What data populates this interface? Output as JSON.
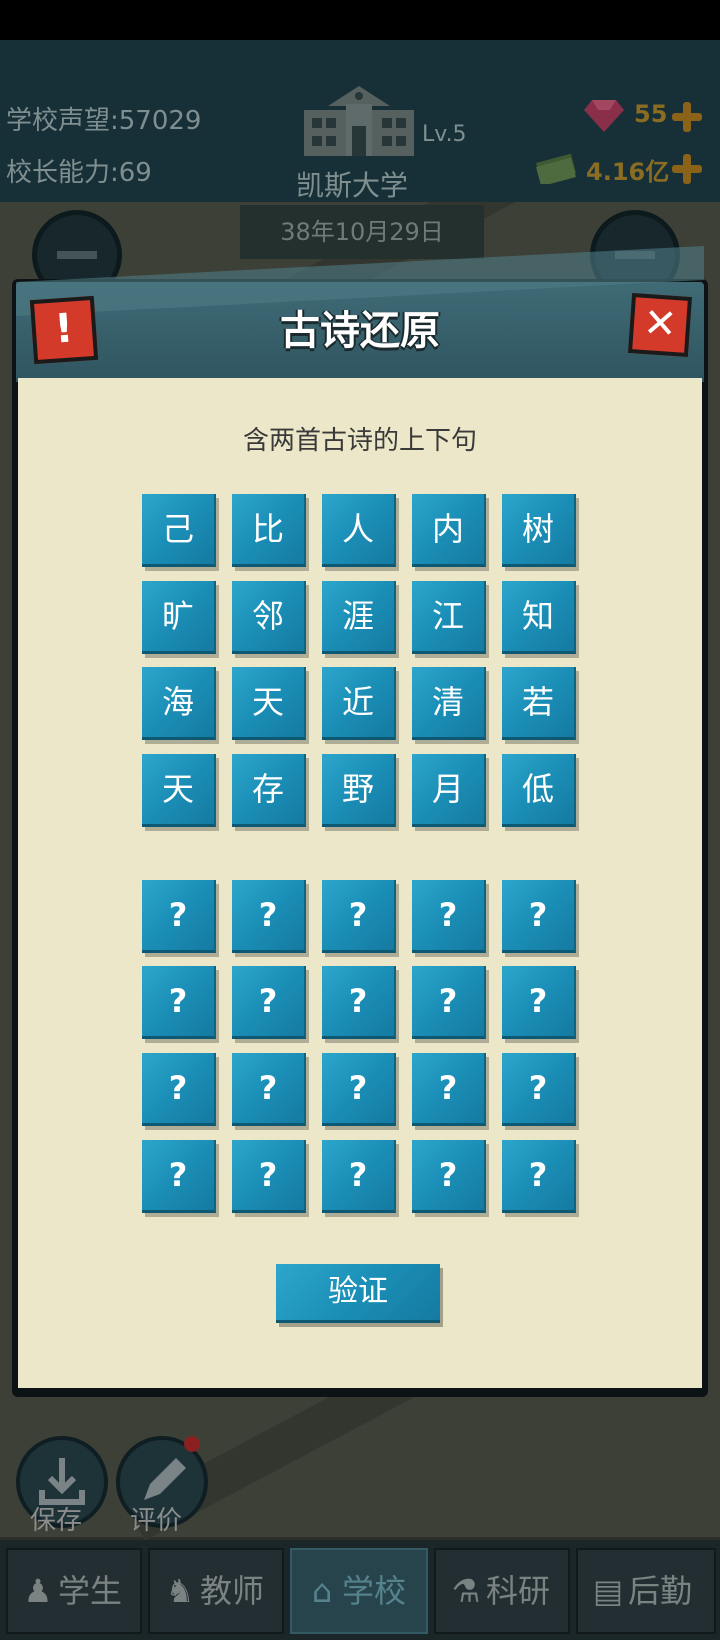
{
  "hud": {
    "reputation_label": "学校声望:",
    "reputation_value": "57029",
    "ability_label": "校长能力:",
    "ability_value": "69",
    "school_level": "Lv.5",
    "school_name": "凯斯大学",
    "date": "38年10月29日",
    "gems": "55",
    "money": "4.16亿"
  },
  "modal": {
    "title": "古诗还原",
    "subtitle": "含两首古诗的上下句",
    "alert_glyph": "!",
    "close_glyph": "✕",
    "char_tiles": [
      "己",
      "比",
      "人",
      "内",
      "树",
      "旷",
      "邻",
      "涯",
      "江",
      "知",
      "海",
      "天",
      "近",
      "清",
      "若",
      "天",
      "存",
      "野",
      "月",
      "低"
    ],
    "answer_slot_glyph": "?",
    "verify_label": "验证"
  },
  "side_actions": [
    {
      "label": "保存",
      "icon": "download-icon"
    },
    {
      "label": "评价",
      "icon": "pencil-icon"
    }
  ],
  "tabs": [
    {
      "label": "学生",
      "icon": "student-icon",
      "active": false
    },
    {
      "label": "教师",
      "icon": "teacher-icon",
      "active": false
    },
    {
      "label": "学校",
      "icon": "school-icon",
      "active": true
    },
    {
      "label": "科研",
      "icon": "flask-icon",
      "active": false
    },
    {
      "label": "后勤",
      "icon": "clipboard-icon",
      "active": false
    }
  ],
  "colors": {
    "tile": "#1b8fb7",
    "panel": "#ebe7c8",
    "danger": "#d43a2a",
    "header": "#3f6b76"
  }
}
